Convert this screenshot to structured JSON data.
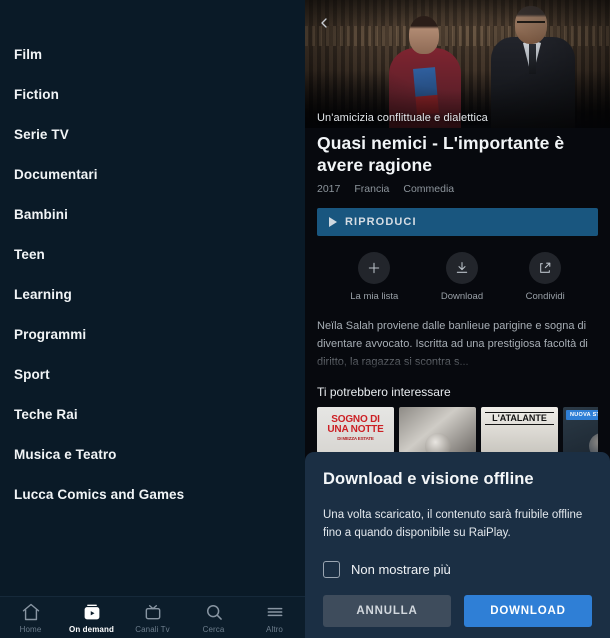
{
  "sidebar": {
    "items": [
      {
        "label": "Film",
        "name": "film"
      },
      {
        "label": "Fiction",
        "name": "fiction"
      },
      {
        "label": "Serie TV",
        "name": "serie-tv"
      },
      {
        "label": "Documentari",
        "name": "documentari"
      },
      {
        "label": "Bambini",
        "name": "bambini"
      },
      {
        "label": "Teen",
        "name": "teen"
      },
      {
        "label": "Learning",
        "name": "learning"
      },
      {
        "label": "Programmi",
        "name": "programmi"
      },
      {
        "label": "Sport",
        "name": "sport"
      },
      {
        "label": "Teche Rai",
        "name": "teche-rai"
      },
      {
        "label": "Musica e Teatro",
        "name": "musica-e-teatro"
      },
      {
        "label": "Lucca Comics and Games",
        "name": "lucca-comics-and-games"
      }
    ]
  },
  "tabbar": {
    "items": [
      {
        "label": "Home",
        "icon": "home-icon",
        "active": false
      },
      {
        "label": "On demand",
        "icon": "on-demand-icon",
        "active": true
      },
      {
        "label": "Canali Tv",
        "icon": "tv-icon",
        "active": false
      },
      {
        "label": "Cerca",
        "icon": "search-icon",
        "active": false
      },
      {
        "label": "Altro",
        "icon": "menu-icon",
        "active": false
      }
    ]
  },
  "detail": {
    "back_icon": "back-chevron-icon",
    "tagline": "Un'amicizia conflittuale e dialettica",
    "title": "Quasi nemici - L'importante è avere ragione",
    "meta": {
      "year": "2017",
      "country": "Francia",
      "genre": "Commedia"
    },
    "play_label": "RIPRODUCI",
    "actions": [
      {
        "label": "La mia lista",
        "icon": "plus-icon",
        "name": "my-list"
      },
      {
        "label": "Download",
        "icon": "download-icon",
        "name": "download"
      },
      {
        "label": "Condividi",
        "icon": "share-icon",
        "name": "share"
      }
    ],
    "synopsis": "Neïla Salah proviene dalle banlieue parigine e sogna di diventare avvocato. Iscritta ad una prestigiosa facoltà di diritto, la ragazza si scontra s...",
    "rail_title": "Ti potrebbero interessare",
    "rail_items": [
      {
        "title": "SOGNO DI UNA NOTTE",
        "subtitle": "DI MEZZA ESTATE",
        "badge": "",
        "style": "card-c0"
      },
      {
        "title": "",
        "subtitle": "",
        "badge": "",
        "style": "card-c1"
      },
      {
        "title": "L'ATALANTE",
        "subtitle": "",
        "badge": "",
        "style": "card-c2"
      },
      {
        "title": "",
        "subtitle": "",
        "badge": "NUOVA STA",
        "style": "card-c3"
      }
    ]
  },
  "sheet": {
    "title": "Download e visione offline",
    "text": "Una volta scaricato, il contenuto sarà fruibile offline fino a quando disponibile su RaiPlay.",
    "checkbox_label": "Non mostrare più",
    "checked": false,
    "cancel_label": "ANNULLA",
    "confirm_label": "DOWNLOAD"
  },
  "colors": {
    "sidebar_bg": "#0a1a27",
    "detail_bg": "#07090e",
    "sheet_bg": "#1b2f44",
    "play_blue": "#19567f",
    "accent_blue": "#2f7fd6",
    "cancel_grey": "#3e4c5c"
  }
}
